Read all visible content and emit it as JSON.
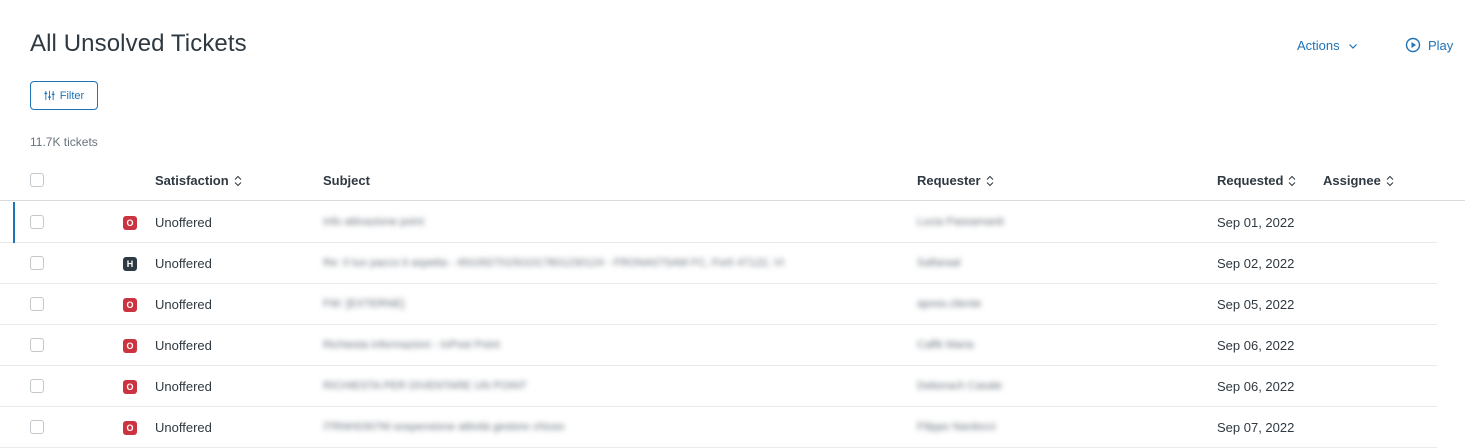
{
  "header": {
    "title": "All Unsolved Tickets",
    "actions_label": "Actions",
    "play_label": "Play"
  },
  "toolbar": {
    "filter_label": "Filter"
  },
  "ticket_count": "11.7K tickets",
  "table": {
    "columns": {
      "satisfaction": "Satisfaction",
      "subject": "Subject",
      "requester": "Requester",
      "requested": "Requested",
      "assignee": "Assignee"
    },
    "rows": [
      {
        "status": "O",
        "status_color": "#cc3340",
        "satisfaction": "Unoffered",
        "subject": "Info attivazione point",
        "requester": "Lucia Passamanti",
        "requested": "Sep 01, 2022",
        "assignee": ""
      },
      {
        "status": "H",
        "status_color": "#2f3941",
        "satisfaction": "Unoffered",
        "subject": "Re: Il tuo pacco ti aspetta - 491092701501017801230124 - FRONA07SAM FC, Forlì 47122, VI",
        "requester": "Safiaraal",
        "requested": "Sep 02, 2022",
        "assignee": ""
      },
      {
        "status": "O",
        "status_color": "#cc3340",
        "satisfaction": "Unoffered",
        "subject": "FW: [EXTERNE]",
        "requester": "aposs.cliente",
        "requested": "Sep 05, 2022",
        "assignee": ""
      },
      {
        "status": "O",
        "status_color": "#cc3340",
        "satisfaction": "Unoffered",
        "subject": "Richiesta informazioni - InPost Point",
        "requester": "Caffè Maria",
        "requested": "Sep 06, 2022",
        "assignee": ""
      },
      {
        "status": "O",
        "status_color": "#cc3340",
        "satisfaction": "Unoffered",
        "subject": "RICHIESTA PER DIVENTARE UN POINT",
        "requester": "Deborach Casale",
        "requested": "Sep 06, 2022",
        "assignee": ""
      },
      {
        "status": "O",
        "status_color": "#cc3340",
        "satisfaction": "Unoffered",
        "subject": "ITRNH0307M sospensione attività gestore chiuso",
        "requester": "Filippo Nardocci",
        "requested": "Sep 07, 2022",
        "assignee": ""
      }
    ]
  },
  "colors": {
    "accent": "#1f73b7",
    "open_badge": "#cc3340",
    "hold_badge": "#2f3941"
  }
}
